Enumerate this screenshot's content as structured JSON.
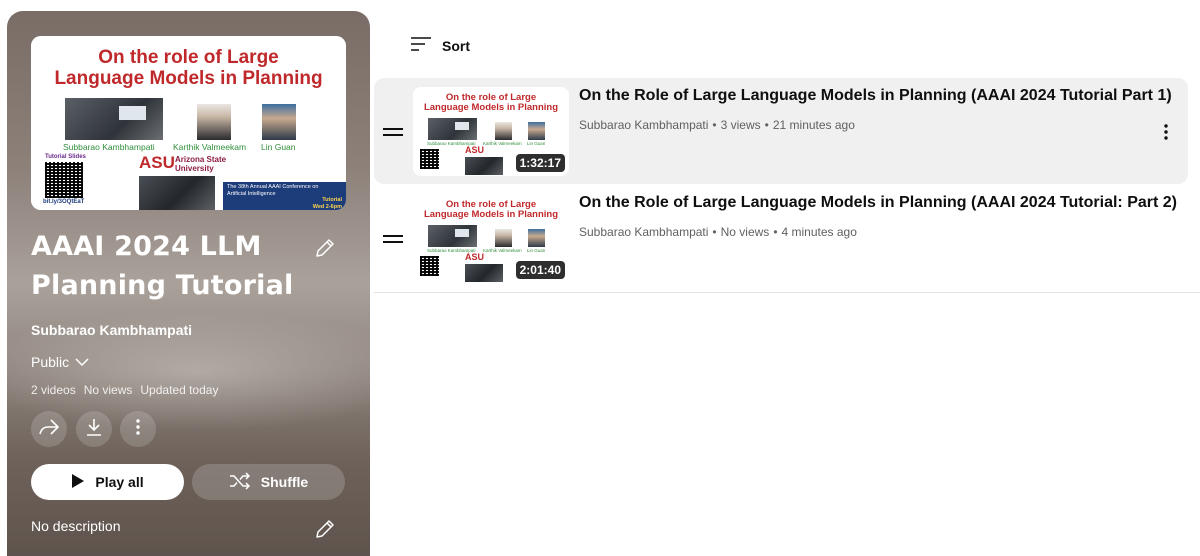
{
  "playlist": {
    "title": "AAAI 2024 LLM Planning Tutorial",
    "owner": "Subbarao Kambhampati",
    "privacy": "Public",
    "video_count": "2 videos",
    "views": "No views",
    "updated": "Updated today",
    "play_all_label": "Play all",
    "shuffle_label": "Shuffle",
    "description": "No description"
  },
  "cover": {
    "title_line1": "On the role of Large",
    "title_line2": "Language Models in Planning",
    "presenters": [
      "Subbarao Kambhampati",
      "Karthik Valmeekam",
      "Lin Guan"
    ],
    "slides_label": "Tutorial Slides",
    "slides_link": "bit.ly/3OQtEaT",
    "university": "Arizona State University",
    "university_abbr": "ASU",
    "banner_line1": "The 38th Annual AAAI Conference on",
    "banner_line2": "Artificial Intelligence",
    "banner_line3": "Tutorial",
    "banner_line4": "Wed 2-6pm"
  },
  "sort_label": "Sort",
  "videos": [
    {
      "title": "On the Role of Large Language Models in Planning (AAAI 2024 Tutorial Part 1)",
      "channel": "Subbarao Kambhampati",
      "views": "3 views",
      "age": "21 minutes ago",
      "duration": "1:32:17"
    },
    {
      "title": "On the Role of Large Language Models in Planning (AAAI 2024 Tutorial: Part 2)",
      "channel": "Subbarao Kambhampati",
      "views": "No views",
      "age": "4 minutes ago",
      "duration": "2:01:40"
    }
  ],
  "colors": {
    "slide_title": "#c0292b",
    "presenter_names": "#2f8f3a",
    "text_primary": "#0f0f0f",
    "text_secondary": "#606060",
    "active_row_bg": "#f0f0f0"
  }
}
